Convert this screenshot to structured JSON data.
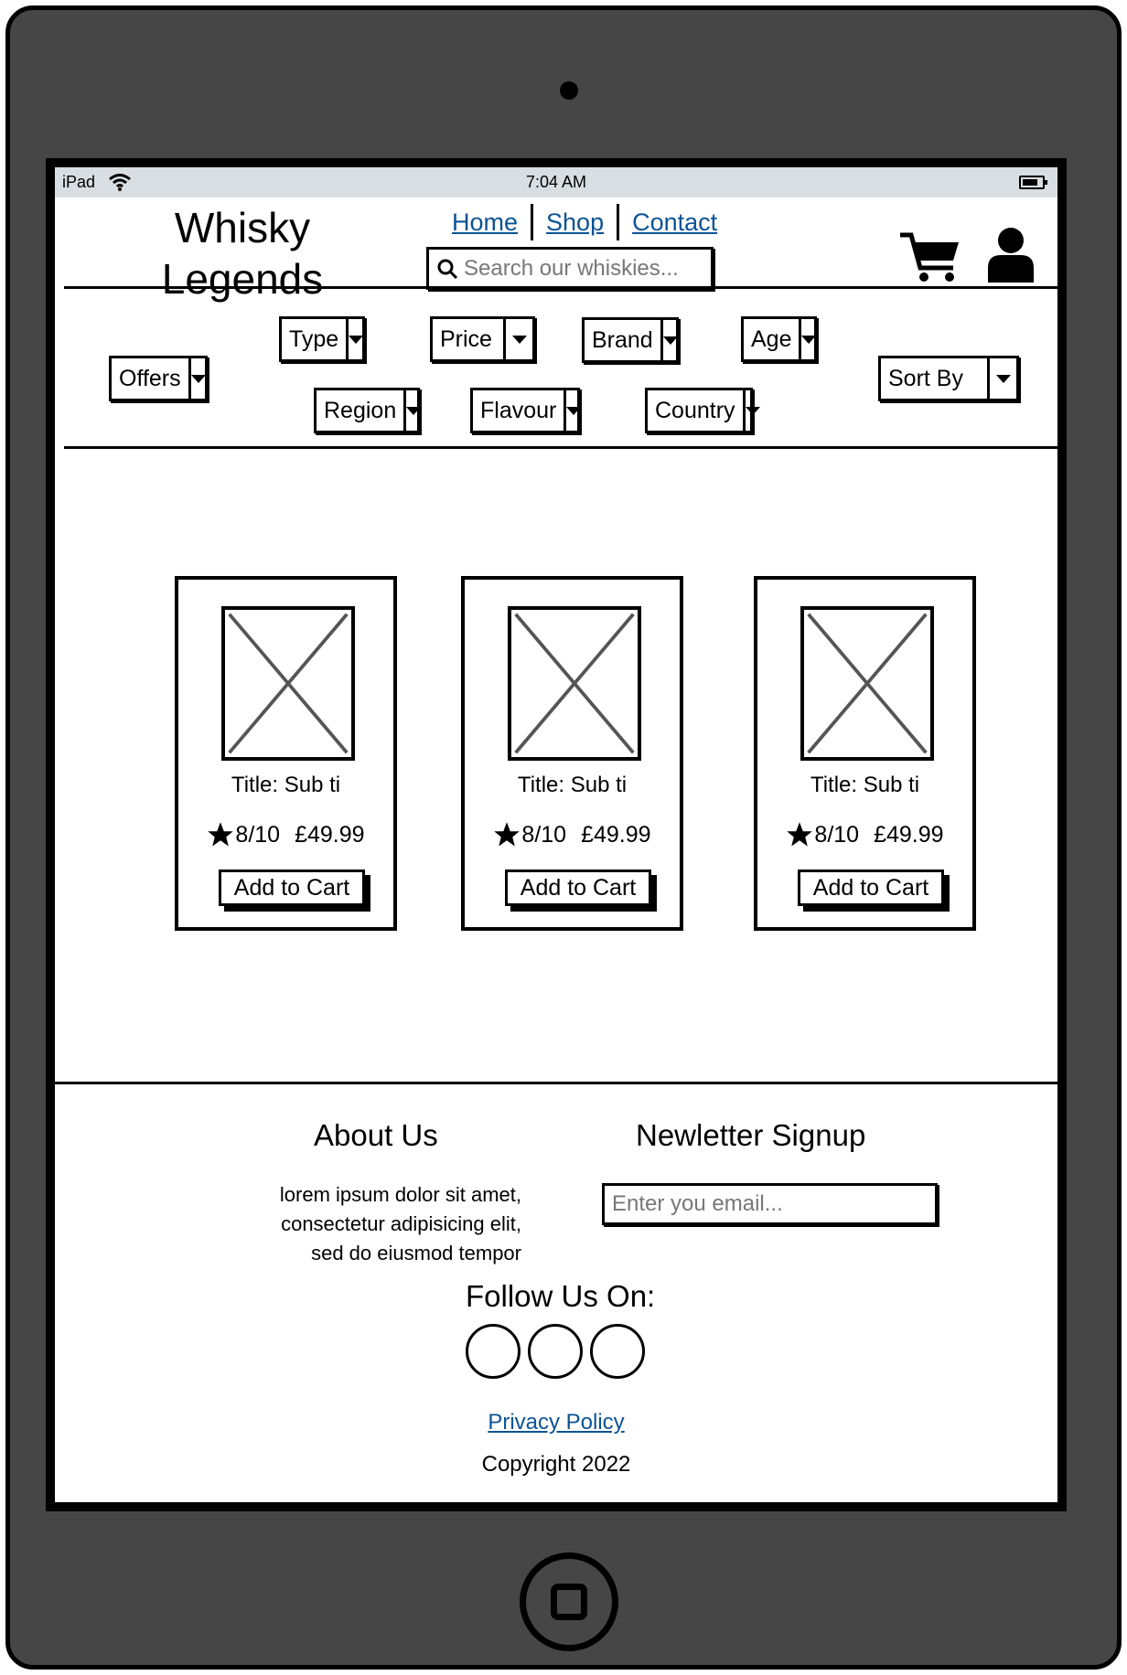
{
  "statusbar": {
    "carrier": "iPad",
    "time": "7:04 AM"
  },
  "header": {
    "brand_line1": "Whisky",
    "brand_line2": "Legends",
    "nav": [
      "Home",
      "Shop",
      "Contact"
    ],
    "search_placeholder": "Search our whiskies..."
  },
  "filters": {
    "offers": "Offers",
    "type": "Type",
    "price": "Price",
    "brand": "Brand",
    "age": "Age",
    "region": "Region",
    "flavour": "Flavour",
    "country": "Country",
    "sort": "Sort By"
  },
  "products": [
    {
      "title": "Title: Sub ti",
      "rating": "8/10",
      "price": "£49.99",
      "button": "Add to Cart"
    },
    {
      "title": "Title: Sub ti",
      "rating": "8/10",
      "price": "£49.99",
      "button": "Add to Cart"
    },
    {
      "title": "Title: Sub ti",
      "rating": "8/10",
      "price": "£49.99",
      "button": "Add to Cart"
    }
  ],
  "footer": {
    "about_heading": "About Us",
    "about_text_line1": "lorem ipsum dolor sit amet,",
    "about_text_line2": "consectetur adipisicing elit,",
    "about_text_line3": "sed do eiusmod tempor",
    "newsletter_heading": "Newletter Signup",
    "email_placeholder": "Enter you email...",
    "follow_heading": "Follow Us On:",
    "privacy": "Privacy Policy",
    "copyright": "Copyright 2022"
  },
  "colors": {
    "link": "#0b5394",
    "device": "#464646",
    "statusbar": "#d9dee2"
  }
}
